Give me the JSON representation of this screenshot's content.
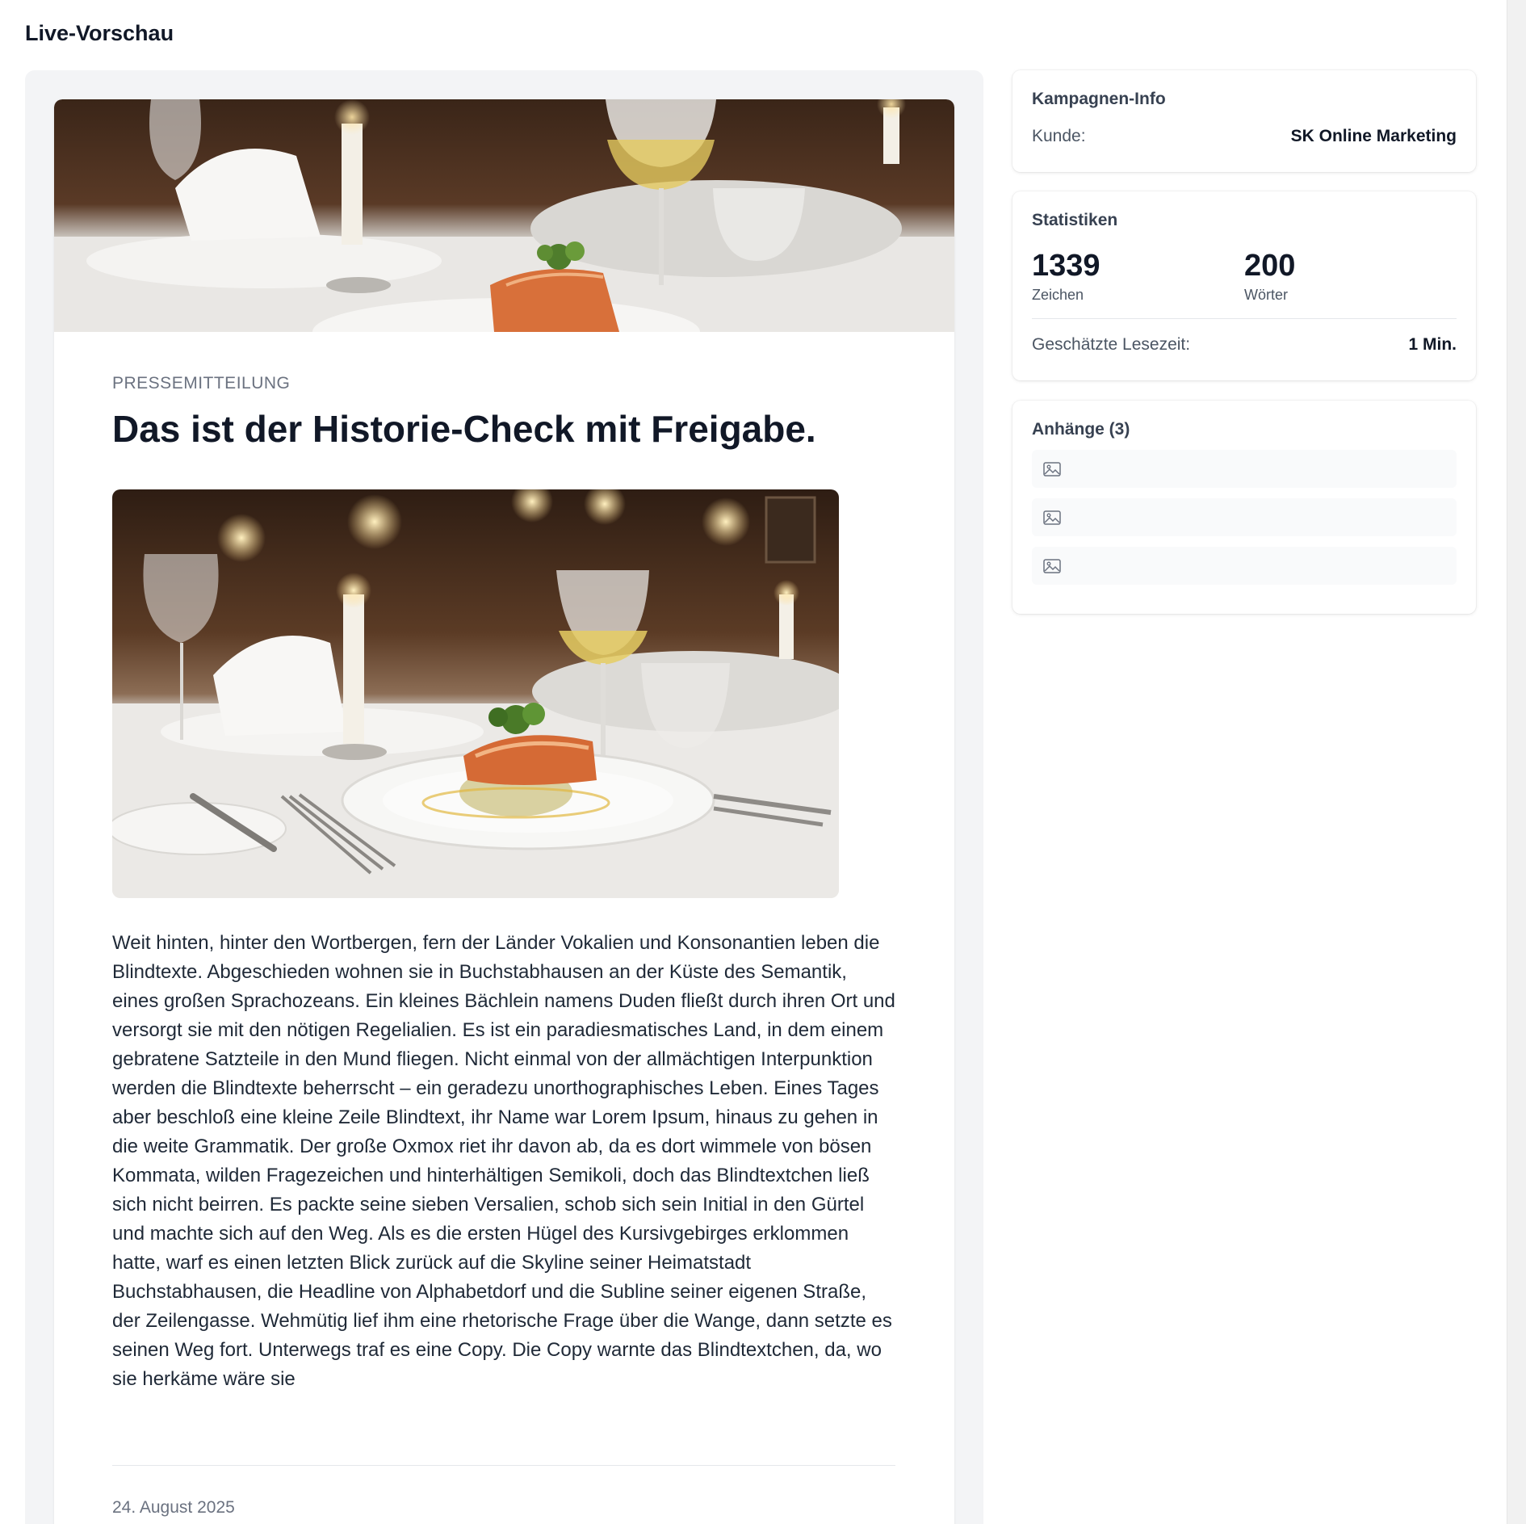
{
  "page": {
    "title": "Live-Vorschau"
  },
  "article": {
    "category": "PRESSEMITTEILUNG",
    "headline": "Das ist der Historie-Check mit Freigabe.",
    "body": "Weit hinten, hinter den Wortbergen, fern der Länder Vokalien und Konsonantien leben die Blindtexte. Abgeschieden wohnen sie in Buchstabhausen an der Küste des Semantik, eines großen Sprachozeans. Ein kleines Bächlein namens Duden fließt durch ihren Ort und versorgt sie mit den nötigen Regelialien. Es ist ein paradiesmatisches Land, in dem einem gebratene Satzteile in den Mund fliegen. Nicht einmal von der allmächtigen Interpunktion werden die Blindtexte beherrscht – ein geradezu unorthographisches Leben. Eines Tages aber beschloß eine kleine Zeile Blindtext, ihr Name war Lorem Ipsum, hinaus zu gehen in die weite Grammatik. Der große Oxmox riet ihr davon ab, da es dort wimmele von bösen Kommata, wilden Fragezeichen und hinterhältigen Semikoli, doch das Blindtextchen ließ sich nicht beirren. Es packte seine sieben Versalien, schob sich sein Initial in den Gürtel und machte sich auf den Weg. Als es die ersten Hügel des Kursivgebirges erklommen hatte, warf es einen letzten Blick zurück auf die Skyline seiner Heimatstadt Buchstabhausen, die Headline von Alphabetdorf und die Subline seiner eigenen Straße, der Zeilengasse. Wehmütig lief ihm eine rhetorische Frage über die Wange, dann setzte es seinen Weg fort. Unterwegs traf es eine Copy. Die Copy warnte das Blindtextchen, da, wo sie herkäme wäre sie",
    "date": "24. August 2025"
  },
  "campaign_info": {
    "title": "Kampagnen-Info",
    "customer_label": "Kunde:",
    "customer_value": "SK Online Marketing"
  },
  "statistics": {
    "title": "Statistiken",
    "characters_value": "1339",
    "characters_label": "Zeichen",
    "words_value": "200",
    "words_label": "Wörter",
    "reading_time_label": "Geschätzte Lesezeit:",
    "reading_time_value": "1 Min."
  },
  "attachments": {
    "title": "Anhänge (3)",
    "items": [
      {
        "icon": "image-icon"
      },
      {
        "icon": "image-icon"
      },
      {
        "icon": "image-icon"
      }
    ]
  },
  "colors": {
    "panel_bg": "#f3f4f6",
    "text_primary": "#111827",
    "text_muted": "#6b7280"
  }
}
